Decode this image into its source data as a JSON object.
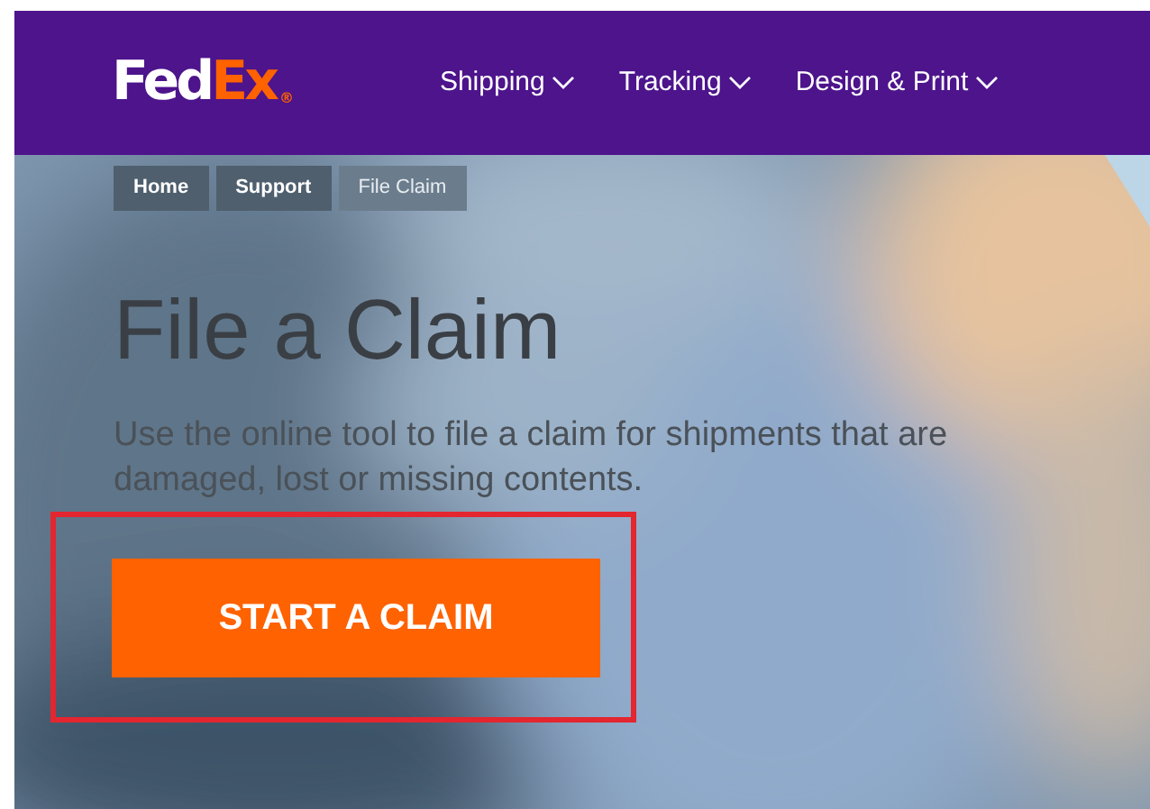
{
  "logo": {
    "first": "Fed",
    "second": "Ex",
    "mark": "®"
  },
  "nav": [
    {
      "label": "Shipping"
    },
    {
      "label": "Tracking"
    },
    {
      "label": "Design & Print"
    }
  ],
  "breadcrumb": [
    {
      "label": "Home",
      "selected": false
    },
    {
      "label": "Support",
      "selected": false
    },
    {
      "label": "File Claim",
      "selected": true
    }
  ],
  "hero": {
    "title": "File a Claim",
    "text": "Use the online tool to file a claim for shipments that are damaged, lost or missing contents.",
    "button": "START A CLAIM",
    "highlighted": true
  }
}
